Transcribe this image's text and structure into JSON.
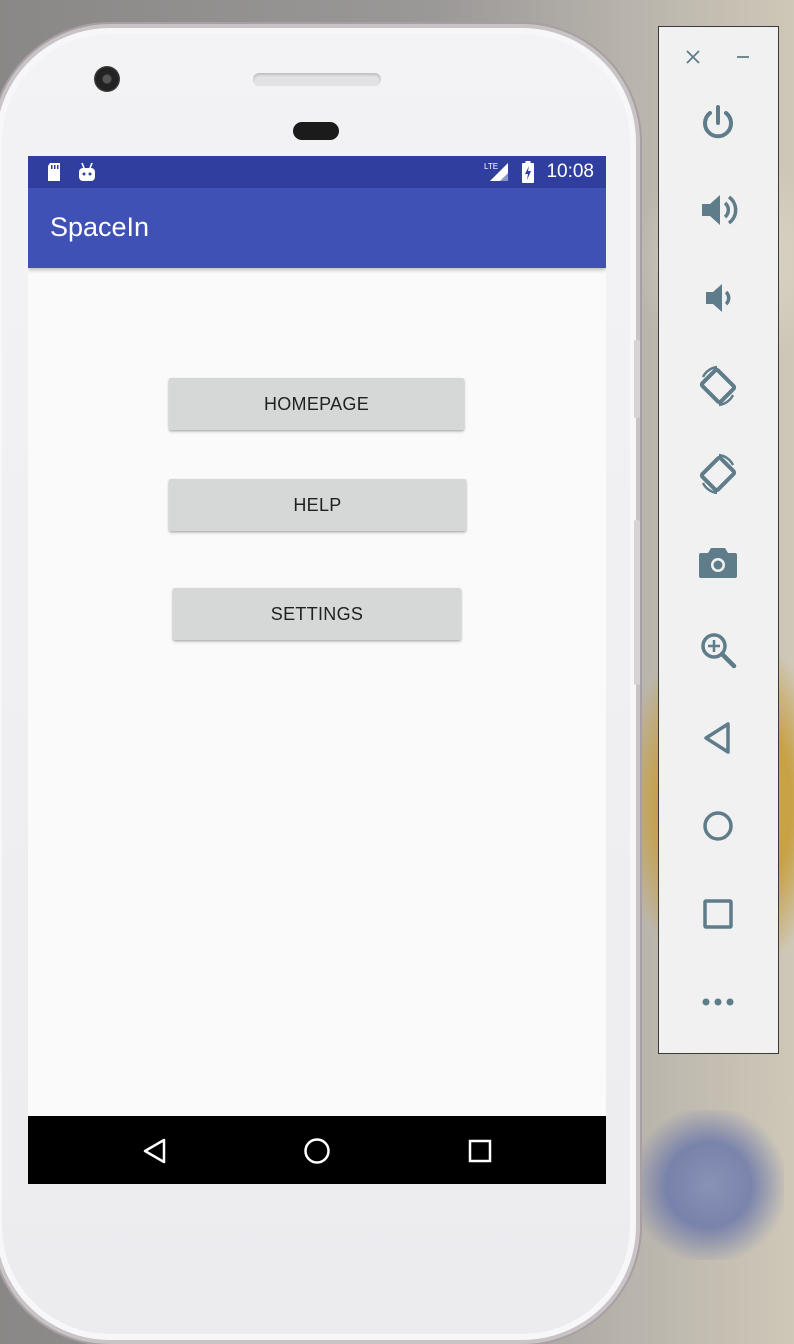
{
  "status_bar": {
    "time": "10:08",
    "network": "LTE",
    "icons": [
      "sd-card-icon",
      "android-icon",
      "lte-signal-icon",
      "battery-charging-icon"
    ]
  },
  "app_bar": {
    "title": "SpaceIn"
  },
  "main": {
    "buttons": [
      {
        "label": "HOMEPAGE"
      },
      {
        "label": "HELP"
      },
      {
        "label": "SETTINGS"
      }
    ]
  },
  "nav_bar": {
    "icons": [
      "back-icon",
      "home-icon",
      "recents-icon"
    ]
  },
  "emulator_toolbar": {
    "window_controls": [
      "close-icon",
      "minimize-icon"
    ],
    "tools": [
      "power-icon",
      "volume-up-icon",
      "volume-down-icon",
      "rotate-left-icon",
      "rotate-right-icon",
      "camera-icon",
      "zoom-icon",
      "back-icon",
      "home-icon",
      "overview-icon",
      "more-icon"
    ]
  },
  "colors": {
    "status_bar": "#303f9f",
    "app_bar": "#3f51b5",
    "button": "#d6d7d7",
    "toolbar_icon": "#5f7c8a"
  }
}
